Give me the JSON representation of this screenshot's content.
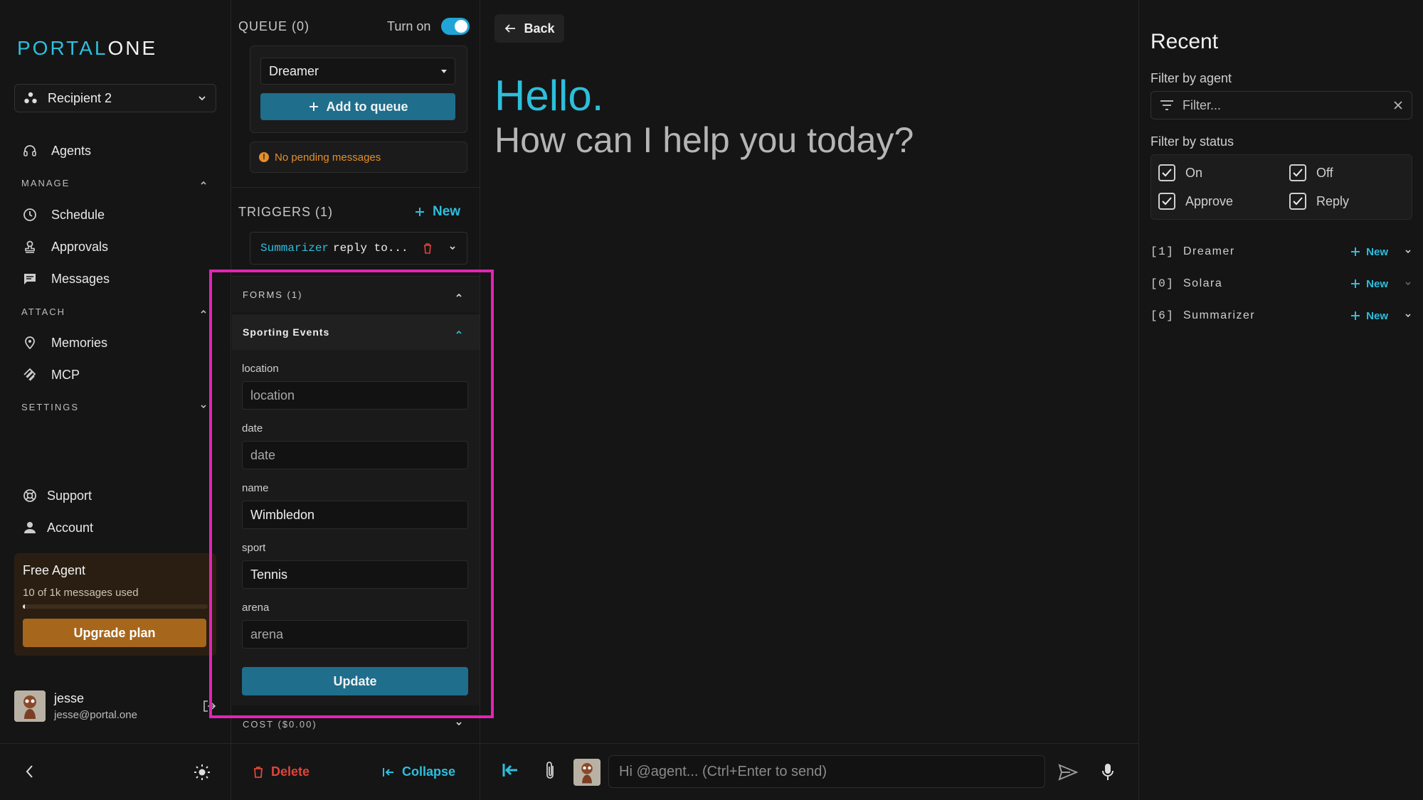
{
  "sidebar": {
    "logo": {
      "part1": "PORTAL",
      "part2": "ONE"
    },
    "recipient": "Recipient 2",
    "agents_label": "Agents",
    "manage_label": "MANAGE",
    "manage_items": [
      "Schedule",
      "Approvals",
      "Messages"
    ],
    "attach_label": "ATTACH",
    "attach_items": [
      "Memories",
      "MCP"
    ],
    "settings_label": "SETTINGS",
    "support_label": "Support",
    "account_label": "Account",
    "plan": {
      "title": "Free Agent",
      "usage": "10 of 1k messages used",
      "progress": 0.01,
      "button": "Upgrade plan"
    },
    "user": {
      "name": "jesse",
      "email": "jesse@portal.one"
    }
  },
  "queue": {
    "label": "QUEUE (0)",
    "toggle_label": "Turn on",
    "toggle_on": true,
    "agent_select": "Dreamer",
    "add_button": "Add to queue",
    "pending": "No pending messages"
  },
  "triggers": {
    "label": "TRIGGERS (1)",
    "new_label": "New",
    "item": {
      "agent": "Summarizer",
      "text": "reply to..."
    }
  },
  "forms": {
    "label": "FORMS (1)",
    "form_title": "Sporting Events",
    "fields": [
      {
        "label": "location",
        "value": "",
        "placeholder": "location"
      },
      {
        "label": "date",
        "value": "",
        "placeholder": "date"
      },
      {
        "label": "name",
        "value": "Wimbledon",
        "placeholder": "name"
      },
      {
        "label": "sport",
        "value": "Tennis",
        "placeholder": "sport"
      },
      {
        "label": "arena",
        "value": "",
        "placeholder": "arena"
      }
    ],
    "update_button": "Update"
  },
  "cost": {
    "label": "COST ($0.00)"
  },
  "panel_footer": {
    "delete": "Delete",
    "collapse": "Collapse"
  },
  "main": {
    "back": "Back",
    "greeting": "Hello.",
    "subgreeting": "How can I help you today?",
    "chat_placeholder": "Hi @agent... (Ctrl+Enter to send)"
  },
  "recent": {
    "title": "Recent",
    "filter_agent_label": "Filter by agent",
    "filter_placeholder": "Filter...",
    "filter_status_label": "Filter by status",
    "statuses": [
      {
        "label": "On",
        "checked": true
      },
      {
        "label": "Off",
        "checked": true
      },
      {
        "label": "Approve",
        "checked": true
      },
      {
        "label": "Reply",
        "checked": true
      }
    ],
    "agents": [
      {
        "index": "[1]",
        "name": "Dreamer",
        "new": "New"
      },
      {
        "index": "[0]",
        "name": "Solara",
        "new": "New"
      },
      {
        "index": "[6]",
        "name": "Summarizer",
        "new": "New"
      }
    ]
  },
  "colors": {
    "accent": "#2dbfdc",
    "primary_button": "#1e6e8c",
    "warning": "#e58f2a",
    "upgrade": "#a6661c",
    "highlight": "#e324b5",
    "danger": "#e0453a"
  }
}
